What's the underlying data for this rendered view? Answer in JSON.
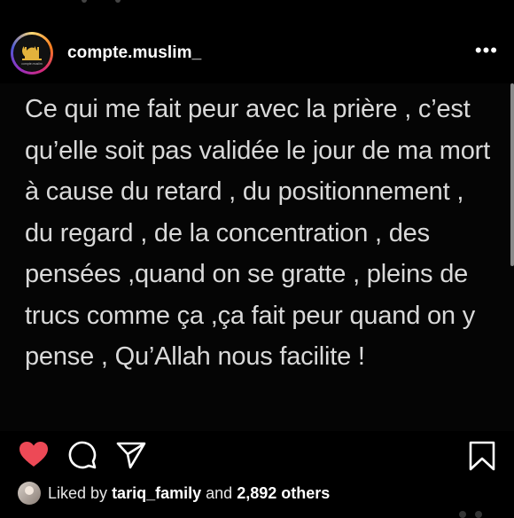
{
  "post": {
    "username": "compte.muslim_",
    "avatar_caption": "compte.muslim",
    "more_label": "•••",
    "text": "Ce qui me fait peur avec la prière , c’est qu’elle soit pas validée le jour de ma mort à cause du retard , du positionnement , du regard , de la concentration , des pensées ,quand on se gratte , pleins de trucs comme ça ,ça fait peur quand on y pense , Qu’Allah nous facilite !"
  },
  "actions": {
    "like_icon": "heart-filled",
    "comment_icon": "comment",
    "share_icon": "paper-plane",
    "save_icon": "bookmark"
  },
  "likes": {
    "prefix": "Liked by",
    "user": "tariq_family",
    "conjunction": "and",
    "count": "2,892 others"
  },
  "colors": {
    "like_red": "#ed4956",
    "text_gray": "#d9d9d9"
  }
}
